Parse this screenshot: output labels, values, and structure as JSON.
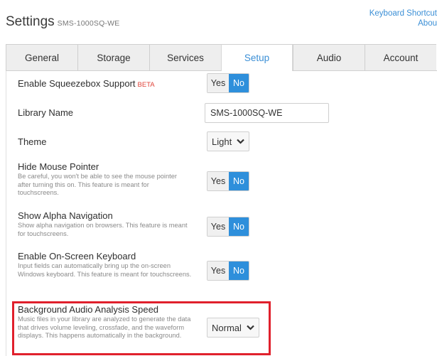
{
  "header": {
    "title": "Settings",
    "device_name": "SMS-1000SQ-WE"
  },
  "top_links": {
    "keyboard_shortcuts": "Keyboard Shortcut",
    "about": "Abou"
  },
  "tabs": [
    {
      "label": "General",
      "active": false
    },
    {
      "label": "Storage",
      "active": false
    },
    {
      "label": "Services",
      "active": false
    },
    {
      "label": "Setup",
      "active": true
    },
    {
      "label": "Audio",
      "active": false
    },
    {
      "label": "Account",
      "active": false
    }
  ],
  "settings": {
    "squeezebox": {
      "title": "Enable Squeezebox Support",
      "badge": "BETA",
      "yes": "Yes",
      "no": "No",
      "selected": "No"
    },
    "library_name": {
      "title": "Library Name",
      "value": "SMS-1000SQ-WE"
    },
    "theme": {
      "title": "Theme",
      "value": "Light"
    },
    "hide_pointer": {
      "title": "Hide Mouse Pointer",
      "description": "Be careful, you won't be able to see the mouse pointer after turning this on. This feature is meant for touchscreens.",
      "yes": "Yes",
      "no": "No",
      "selected": "No"
    },
    "alpha_nav": {
      "title": "Show Alpha Navigation",
      "description": "Show alpha navigation on browsers. This feature is meant for touchscreens.",
      "yes": "Yes",
      "no": "No",
      "selected": "No"
    },
    "onscreen_keyboard": {
      "title": "Enable On-Screen Keyboard",
      "description": "Input fields can automatically bring up the on-screen Windows keyboard. This feature is meant for touchscreens.",
      "yes": "Yes",
      "no": "No",
      "selected": "No"
    },
    "analysis_speed": {
      "title": "Background Audio Analysis Speed",
      "description": "Music files in your library are analyzed to generate the data that drives volume leveling, crossfade, and the waveform displays. This happens automatically in the background.",
      "value": "Normal"
    }
  },
  "colors": {
    "accent": "#2e8fdb",
    "link": "#3b8fd6",
    "beta": "#e0443a",
    "highlight": "#e0202c"
  }
}
